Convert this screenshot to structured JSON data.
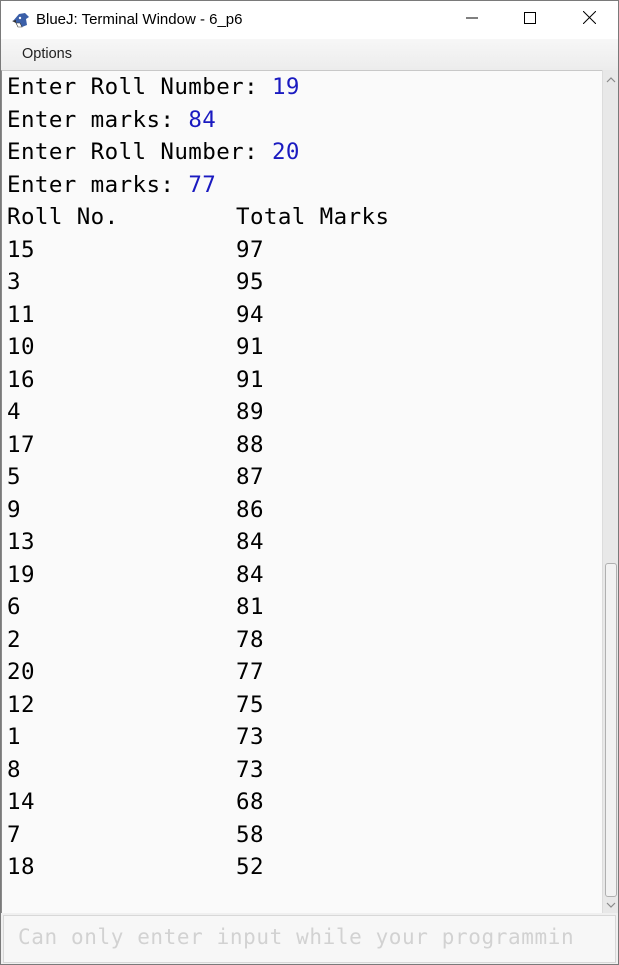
{
  "window": {
    "title": "BlueJ: Terminal Window - 6_p6",
    "controls": {
      "minimize": "minimize",
      "maximize": "maximize",
      "close": "close"
    }
  },
  "menubar": {
    "items": [
      {
        "label": "Options"
      }
    ]
  },
  "terminal": {
    "input_lines": [
      {
        "prompt": "Enter Roll Number: ",
        "value": "19"
      },
      {
        "prompt": "Enter marks: ",
        "value": "84"
      },
      {
        "prompt": "Enter Roll Number: ",
        "value": "20"
      },
      {
        "prompt": "Enter marks: ",
        "value": "77"
      }
    ],
    "table": {
      "headers": [
        "Roll No.",
        "Total Marks"
      ],
      "rows": [
        [
          "15",
          "97"
        ],
        [
          "3",
          "95"
        ],
        [
          "11",
          "94"
        ],
        [
          "10",
          "91"
        ],
        [
          "16",
          "91"
        ],
        [
          "4",
          "89"
        ],
        [
          "17",
          "88"
        ],
        [
          "5",
          "87"
        ],
        [
          "9",
          "86"
        ],
        [
          "13",
          "84"
        ],
        [
          "19",
          "84"
        ],
        [
          "6",
          "81"
        ],
        [
          "2",
          "78"
        ],
        [
          "20",
          "77"
        ],
        [
          "12",
          "75"
        ],
        [
          "1",
          "73"
        ],
        [
          "8",
          "73"
        ],
        [
          "14",
          "68"
        ],
        [
          "7",
          "58"
        ],
        [
          "18",
          "52"
        ]
      ]
    },
    "scroll_position_fraction": 0.6
  },
  "input_bar": {
    "placeholder": "Can only enter input while your programmin"
  },
  "colors": {
    "input_value": "#1a1ac0",
    "output_text": "#000000",
    "placeholder": "#d2d2d2"
  }
}
